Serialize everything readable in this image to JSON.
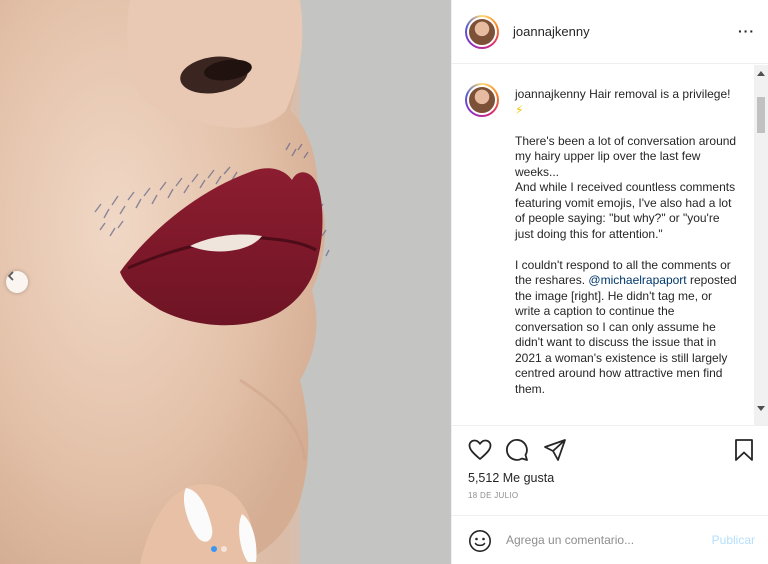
{
  "post": {
    "username": "joannajkenny",
    "more_label": "···",
    "caption_title": "Hair removal is a privilege!",
    "caption_emoji": "⚡",
    "paragraph1": "There's been a lot of conversation around my hairy upper lip over the last few weeks...",
    "paragraph2": "And while I received countless comments featuring vomit emojis, I've also had a lot of people saying: \"but why?\" or \"you're just doing this for attention.\"",
    "paragraph3_start": "I couldn't respond to all the comments or the reshares.",
    "mention": "@michaelrapaport",
    "paragraph3_end": "reposted the image [right]. He didn't tag me, or write a caption to continue the conversation so I can only assume he didn't want to discuss the issue that in 2021 a woman's existence is still largely centred around how attractive men find them."
  },
  "stats": {
    "likes": "5,512 Me gusta",
    "date": "18 DE JULIO"
  },
  "comment": {
    "placeholder": "Agrega un comentario...",
    "publish_label": "Publicar"
  },
  "carousel": {
    "total": 2,
    "active_index": 1
  },
  "colors": {
    "link": "#00376b",
    "publish_disabled": "#b2dffc",
    "carousel_active_dot": "#3897f0"
  },
  "icons": [
    "chevron-left-icon",
    "heart-icon",
    "comment-icon",
    "share-icon",
    "bookmark-icon",
    "emoji-icon",
    "lightning-icon"
  ]
}
